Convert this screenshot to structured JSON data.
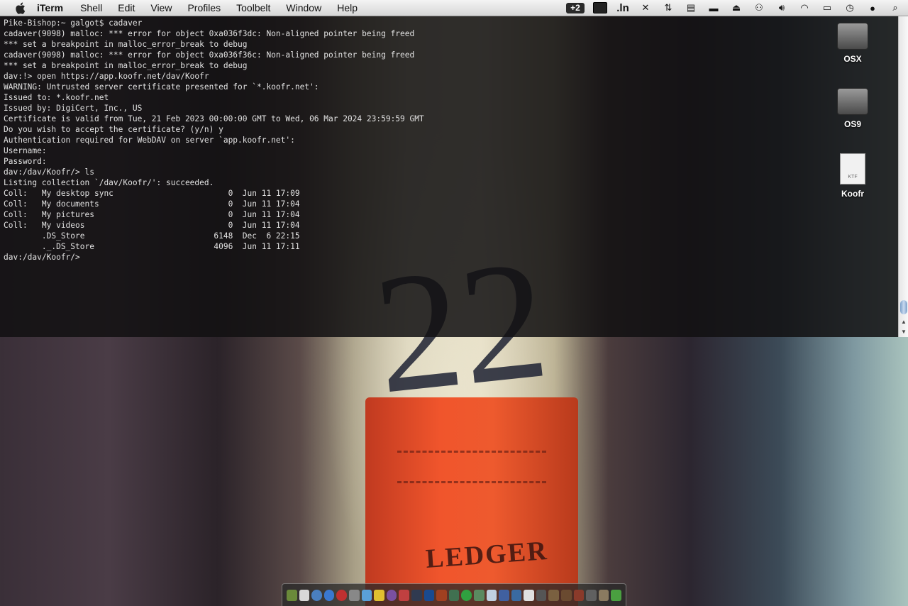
{
  "menubar": {
    "app_name": "iTerm",
    "items": [
      "Shell",
      "Edit",
      "View",
      "Profiles",
      "Toolbelt",
      "Window",
      "Help"
    ],
    "status_badge": "+2",
    "dotln_label": ".ln"
  },
  "terminal": {
    "lines": [
      "Pike-Bishop:~ galgot$ cadaver",
      "cadaver(9098) malloc: *** error for object 0xa036f3dc: Non-aligned pointer being freed",
      "*** set a breakpoint in malloc_error_break to debug",
      "cadaver(9098) malloc: *** error for object 0xa036f36c: Non-aligned pointer being freed",
      "*** set a breakpoint in malloc_error_break to debug",
      "dav:!> open https://app.koofr.net/dav/Koofr",
      "WARNING: Untrusted server certificate presented for `*.koofr.net':",
      "Issued to: *.koofr.net",
      "Issued by: DigiCert, Inc., US",
      "Certificate is valid from Tue, 21 Feb 2023 00:00:00 GMT to Wed, 06 Mar 2024 23:59:59 GMT",
      "Do you wish to accept the certificate? (y/n) y",
      "Authentication required for WebDAV on server `app.koofr.net':",
      "Username: ",
      "Password: ",
      "dav:/dav/Koofr/> ls",
      "Listing collection `/dav/Koofr/': succeeded.",
      "Coll:   My desktop sync                        0  Jun 11 17:09",
      "Coll:   My documents                           0  Jun 11 17:04",
      "Coll:   My pictures                            0  Jun 11 17:04",
      "Coll:   My videos                              0  Jun 11 17:04",
      "        .DS_Store                           6148  Dec  6 22:15",
      "        ._.DS_Store                         4096  Jun 11 17:11",
      "dav:/dav/Koofr/>"
    ]
  },
  "desktop": {
    "icons": [
      {
        "label": "OSX"
      },
      {
        "label": "OS9"
      },
      {
        "label": "Koofr",
        "doc_tag": "KTF"
      }
    ]
  },
  "wallpaper": {
    "number": "22",
    "label": "LEDGER"
  },
  "colors": {
    "terminal_bg": "#121012",
    "terminal_fg": "#e2e2e2",
    "ledger_red": "#ee5a2e"
  }
}
